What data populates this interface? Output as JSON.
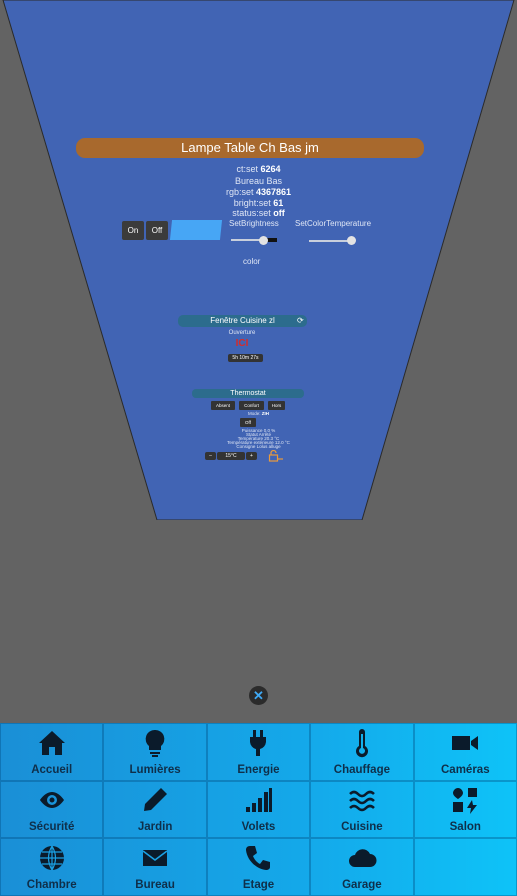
{
  "lamp": {
    "title": "Lampe Table Ch Bas jm",
    "ct_label": "ct:set",
    "ct_value": "6264",
    "room": "Bureau Bas",
    "rgb_label": "rgb:set",
    "rgb_value": "4367861",
    "bright_label": "bright:set",
    "bright_value": "61",
    "status_label": "status:set",
    "status_value": "off",
    "on_label": "On",
    "off_label": "Off",
    "set_brightness": "SetBrightness",
    "set_color_temperature": "SetColorTemperature",
    "color_label": "color",
    "swatch_color": "#47a6f5",
    "brightness_level": 0.7,
    "color_temperature_level": 0.95
  },
  "window_tile": {
    "title": "Fenêtre Cuisine zl",
    "refresh_icon": "refresh-icon",
    "opening_label": "Ouverture",
    "state": "ICI",
    "duration": "5h 10m 27s"
  },
  "thermostat": {
    "title": "Thermostat",
    "modes": [
      "Absent",
      "Confort",
      "Hors"
    ],
    "mode_label": "Mode:",
    "mode_value": "ZIH",
    "off_label": "Off",
    "lines": [
      "Puissance 0.0 %",
      "Statut Arrêté",
      "Température 20.3 °C",
      "Température extérieure 12.0 °C",
      "Consigne         Lolus alluge"
    ],
    "minus": "–",
    "setpoint": "15°C",
    "plus": "+"
  },
  "close": {
    "symbol": "✕"
  },
  "nav": [
    {
      "label": "Accueil",
      "icon": "home-icon"
    },
    {
      "label": "Lumières",
      "icon": "lightbulb-icon"
    },
    {
      "label": "Energie",
      "icon": "plug-icon"
    },
    {
      "label": "Chauffage",
      "icon": "thermometer-icon"
    },
    {
      "label": "Caméras",
      "icon": "video-camera-icon"
    },
    {
      "label": "Sécurité",
      "icon": "eye-icon"
    },
    {
      "label": "Jardin",
      "icon": "pencil-icon"
    },
    {
      "label": "Volets",
      "icon": "signal-bars-icon"
    },
    {
      "label": "Cuisine",
      "icon": "waves-icon"
    },
    {
      "label": "Salon",
      "icon": "shapes-icon"
    },
    {
      "label": "Chambre",
      "icon": "globe-icon"
    },
    {
      "label": "Bureau",
      "icon": "envelope-icon"
    },
    {
      "label": "Etage",
      "icon": "phone-icon"
    },
    {
      "label": "Garage",
      "icon": "cloud-icon"
    }
  ],
  "colors": {
    "panel": "#4164b4",
    "accent_title": "#a8692d",
    "nav_start": "#1a8fd6",
    "nav_end": "#0ec3f8"
  }
}
